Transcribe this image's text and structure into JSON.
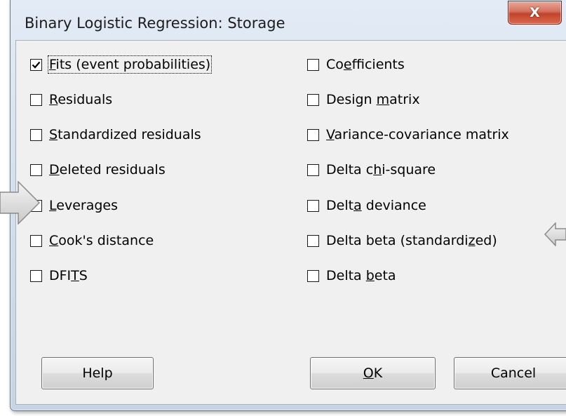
{
  "window": {
    "title": "Binary Logistic Regression: Storage",
    "close_symbol": "X"
  },
  "left_column": [
    {
      "pre": "",
      "mnemonic": "F",
      "post": "its (event probabilities)",
      "checked": true
    },
    {
      "pre": "",
      "mnemonic": "R",
      "post": "esiduals",
      "checked": false
    },
    {
      "pre": "",
      "mnemonic": "S",
      "post": "tandardized residuals",
      "checked": false
    },
    {
      "pre": "",
      "mnemonic": "D",
      "post": "eleted residuals",
      "checked": false
    },
    {
      "pre": "",
      "mnemonic": "L",
      "post": "everages",
      "checked": false
    },
    {
      "pre": "",
      "mnemonic": "C",
      "post": "ook's distance",
      "checked": false
    },
    {
      "pre": "DFI",
      "mnemonic": "T",
      "post": "S",
      "checked": false
    }
  ],
  "right_column": [
    {
      "pre": "Co",
      "mnemonic": "e",
      "post": "fficients",
      "checked": false
    },
    {
      "pre": "Design ",
      "mnemonic": "m",
      "post": "atrix",
      "checked": false
    },
    {
      "pre": "",
      "mnemonic": "V",
      "post": "ariance-covariance matrix",
      "checked": false
    },
    {
      "pre": "Delta c",
      "mnemonic": "h",
      "post": "i-square",
      "checked": false
    },
    {
      "pre": "Delt",
      "mnemonic": "a",
      "post": " deviance",
      "checked": false
    },
    {
      "pre": "Delta beta (standardi",
      "mnemonic": "z",
      "post": "ed)",
      "checked": false
    },
    {
      "pre": "Delta ",
      "mnemonic": "b",
      "post": "eta",
      "checked": false
    }
  ],
  "buttons": {
    "help": "Help",
    "ok_mnemonic": "O",
    "ok_rest": "K",
    "cancel": "Cancel"
  }
}
